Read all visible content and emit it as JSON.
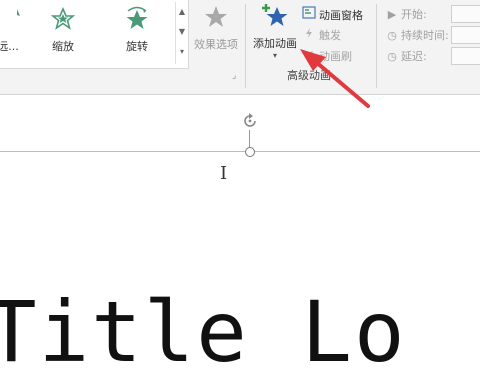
{
  "ribbon": {
    "gallery": {
      "items": [
        {
          "label": "远...",
          "icon": "fly-in-icon"
        },
        {
          "label": "缩放",
          "icon": "zoom-star-icon"
        },
        {
          "label": "旋转",
          "icon": "spin-star-icon"
        }
      ]
    },
    "effect_options": {
      "label": "效果选项",
      "icon": "star-icon"
    },
    "advanced": {
      "add_animation": {
        "label": "添加动画",
        "icon": "add-animation-star-icon"
      },
      "animation_pane": {
        "label": "动画窗格"
      },
      "trigger": {
        "label": "触发"
      },
      "animation_painter": {
        "label": "动画刷"
      },
      "group_label": "高级动画"
    },
    "timing": {
      "start": {
        "label": "开始:"
      },
      "duration": {
        "label": "持续时间:"
      },
      "delay": {
        "label": "延迟:"
      }
    }
  },
  "slide": {
    "title_text": "Title Lo"
  },
  "colors": {
    "accent_star_green": "#4a9a7a",
    "add_star_blue": "#2d63b0",
    "arrow_red": "#e0393e"
  }
}
